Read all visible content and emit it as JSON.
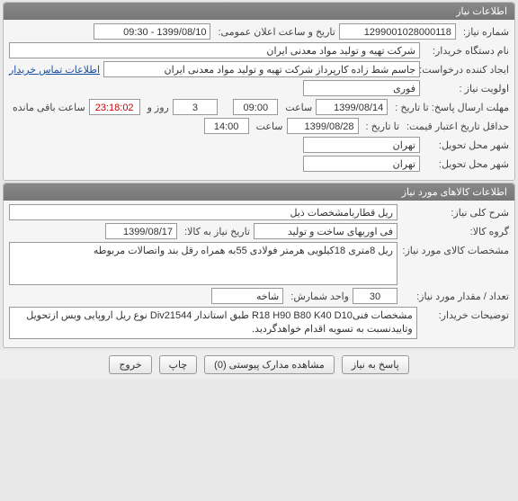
{
  "panel1": {
    "title": "اطلاعات نیاز",
    "need_no_label": "شماره نیاز:",
    "need_no": "1299001028000118",
    "public_datetime_label": "تاریخ و ساعت اعلان عمومی:",
    "public_datetime": "1399/08/10 - 09:30",
    "buyer_label": "نام دستگاه خریدار:",
    "buyer": "شرکت تهیه و تولید مواد معدنی ایران",
    "requester_label": "ایجاد کننده درخواست:",
    "requester": "جاسم شط زاده کارپرداز شرکت تهیه و تولید مواد معدنی ایران",
    "contact_link": "اطلاعات تماس خریدار",
    "priority_label": "اولویت نیاز :",
    "priority": "فوری",
    "reply_deadline_label": "مهلت ارسال پاسخ:  تا تاریخ :",
    "reply_deadline_date": "1399/08/14",
    "time_label": "ساعت",
    "reply_deadline_time": "09:00",
    "days_remaining": "3",
    "days_remaining_label": "روز و",
    "countdown": "23:18:02",
    "countdown_label": "ساعت باقی مانده",
    "price_validity_label": "حداقل تاریخ اعتبار قیمت:",
    "price_validity_to_label": "تا تاریخ :",
    "price_validity_date": "1399/08/28",
    "price_validity_time": "14:00",
    "delivery_city_label": "شهر محل تحویل:",
    "delivery_city": "تهران",
    "delivery_city2_label": "شهر محل تحویل:",
    "delivery_city2": "تهران"
  },
  "panel2": {
    "title": "اطلاعات کالاهای مورد نیاز",
    "main_desc_label": "شرح کلی نیاز:",
    "main_desc": "ریل قطاربامشخصات ذیل",
    "group_label": "گروه کالا:",
    "group": "فی اوریهای ساخت و تولید",
    "need_date_label": "تاریخ نیاز به کالا:",
    "need_date": "1399/08/17",
    "item_spec_label": "مشخصات کالای مورد نیاز:",
    "item_spec": "ریل 8متری 18کیلویی هرمتر فولادی 55به همراه رقل بند واتصالات مربوطه",
    "qty_label": "تعداد / مقدار مورد نیاز:",
    "qty": "30",
    "unit_label": "واحد شمارش:",
    "unit": "شاخه",
    "buyer_notes_label": "توضیحات خریدار:",
    "buyer_notes": "مشخصات فنیR18 H90 B80 K40 D10 طبق استاندار Div21544 نوع ریل اروپایی ویس ازتحویل وتاییدنسبت به تسویه اقدام خواهدگردید."
  },
  "buttons": {
    "reply": "پاسخ به نیاز",
    "attachments": "مشاهده مدارک پیوستی (0)",
    "print": "چاپ",
    "exit": "خروج"
  }
}
